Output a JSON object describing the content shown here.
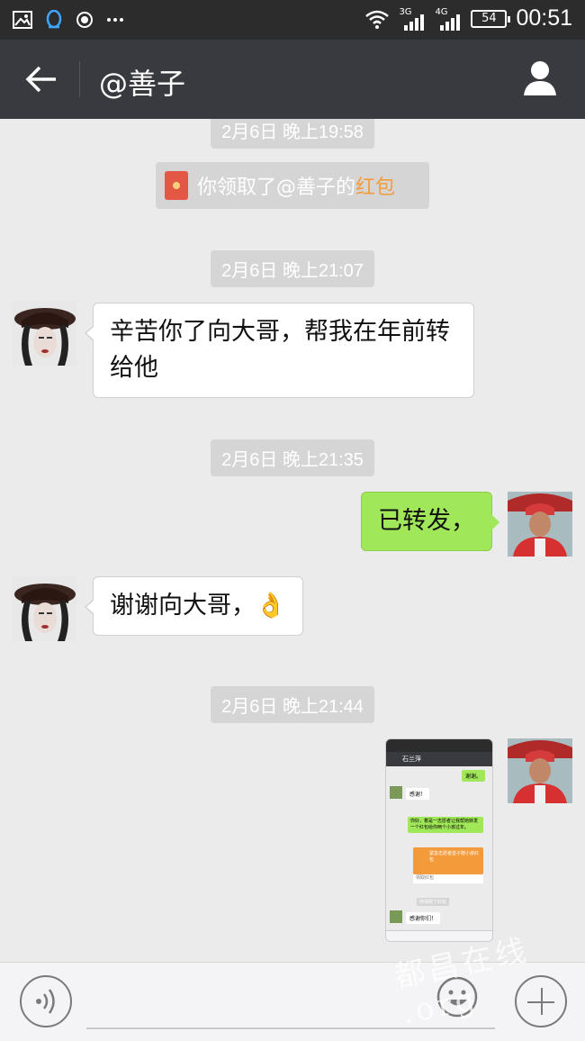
{
  "status_bar": {
    "time": "00:51",
    "battery": "54",
    "net1_label": "3G",
    "net2_label": "4G",
    "icons": [
      "image-icon",
      "qq-icon",
      "record-icon",
      "more-icon",
      "wifi-icon",
      "signal-icon",
      "battery-icon"
    ]
  },
  "header": {
    "title": "@善子",
    "back_icon": "arrow-left-icon",
    "profile_icon": "person-icon"
  },
  "chat": {
    "timestamps": [
      "2月6日 晚上19:58",
      "2月6日 晚上21:07",
      "2月6日 晚上21:35",
      "2月6日 晚上21:44"
    ],
    "system_notice": {
      "prefix": "你领取了@善子的",
      "highlight": "红包"
    },
    "messages": [
      {
        "side": "left",
        "text": "辛苦你了向大哥，帮我在年前转给他"
      },
      {
        "side": "right",
        "text": "已转发，"
      },
      {
        "side": "left",
        "text": "谢谢向大哥，👌"
      }
    ],
    "screenshot_message": {
      "header_title": "石兰萍",
      "items": [
        "谢谢。",
        "感谢！",
        "你好，着是一志愿者让我帮她转发一个红包给你两个小孩过年。",
        "紧急志愿者善子赠小孩红包",
        "领取红包",
        "你领取了红包",
        "感谢你们！"
      ]
    }
  },
  "input_bar": {
    "voice_icon": "voice-icon",
    "emoji_icon": "emoji-icon",
    "plus_icon": "plus-icon"
  },
  "watermark": "都昌在线 .org",
  "colors": {
    "title_bar": "#393a3f",
    "status_bar": "#2c2c2c",
    "chat_bg": "#ebebeb",
    "bubble_out": "#a0e759",
    "bubble_in": "#ffffff",
    "red_packet": "#e35745",
    "highlight": "#f39c3c"
  }
}
